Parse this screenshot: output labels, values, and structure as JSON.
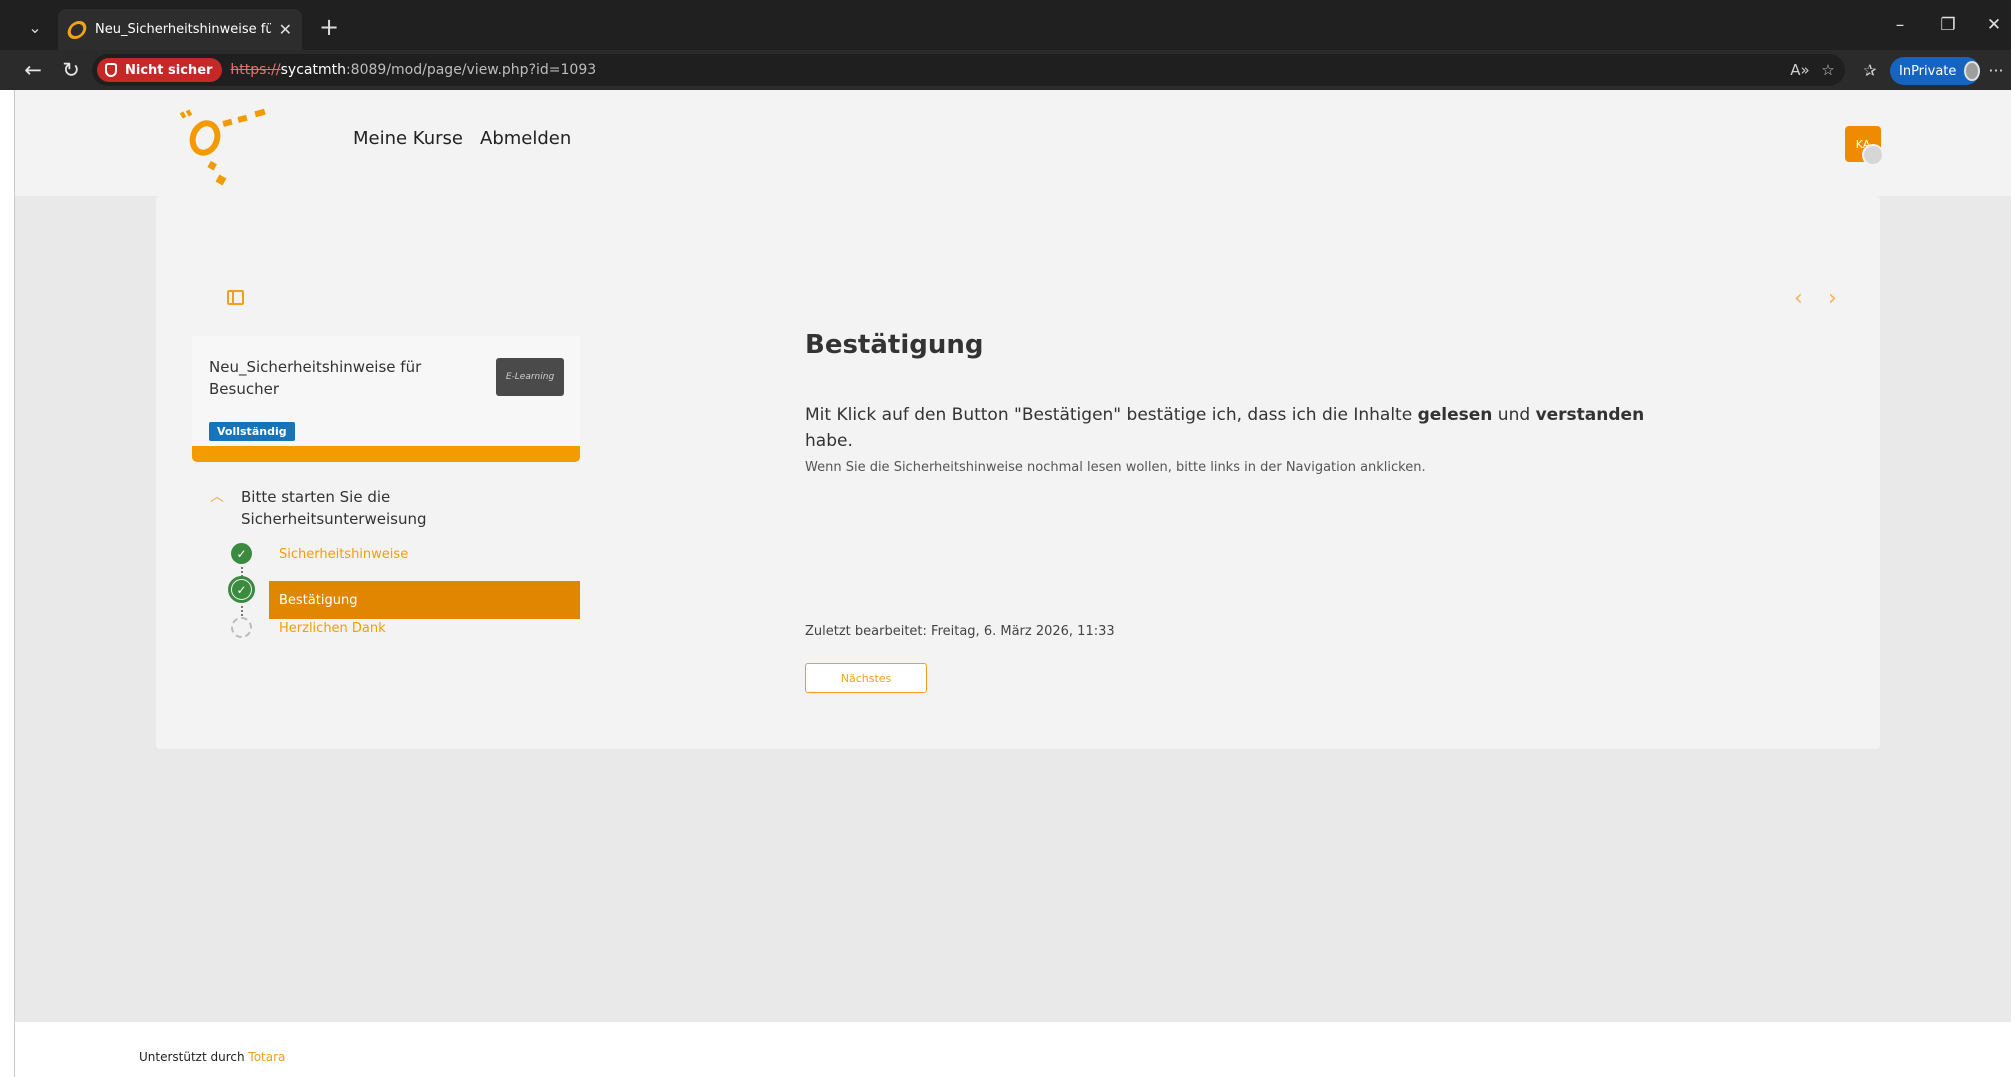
{
  "browser": {
    "tab_title": "Neu_Sicherheitshinweise für Besucher",
    "new_tab_glyph": "+",
    "security_label": "Nicht sicher",
    "url_scheme": "https://",
    "url_host": "sycatmth",
    "url_path": ":8089/mod/page/view.php?id=1093",
    "inprivate_label": "InPrivate",
    "icons": {
      "tab_list": "chevron-down-icon",
      "back": "back-arrow-icon",
      "reload": "reload-icon",
      "read_aloud": "read-aloud-icon",
      "favorite": "star-icon",
      "favorites": "favorites-icon",
      "more": "more-icon",
      "minimize": "minimize-icon",
      "restore": "restore-icon",
      "close": "close-icon"
    }
  },
  "header": {
    "nav": [
      "Meine Kurse",
      "Abmelden"
    ],
    "avatar_initials": "KA"
  },
  "course": {
    "title": "Neu_Sicherheitshinweise für Besucher",
    "thumbnail_text": "E-Learning",
    "status": "Vollständig",
    "progress": 1.0,
    "section_title": "Bitte starten Sie die Sicherheitsunterweisung",
    "activities": [
      {
        "label": "Sicherheitshinweise",
        "state": "done"
      },
      {
        "label": "Bestätigung",
        "state": "current"
      },
      {
        "label": "Herzlichen Dank",
        "state": "pending"
      }
    ]
  },
  "main": {
    "heading": "Bestätigung",
    "text_part1": "Mit Klick auf den Button \"Bestätigen\" bestätige ich, dass ich die Inhalte ",
    "text_bold1": "gelesen",
    "text_part2": " und ",
    "text_bold2": "verstanden",
    "text_part3": " habe.",
    "hint": "Wenn Sie die Sicherheitshinweise nochmal lesen wollen, bitte links in der Navigation anklicken.",
    "last_modified": "Zuletzt bearbeitet: Freitag, 6. März 2026, 11:33",
    "next_button": "Nächstes"
  },
  "footer": {
    "text": "Unterstützt durch ",
    "link": "Totara"
  },
  "colors": {
    "accent": "#f49b00",
    "active_item": "#e08600",
    "status_badge": "#1774b8",
    "success": "#3a8a3f"
  }
}
